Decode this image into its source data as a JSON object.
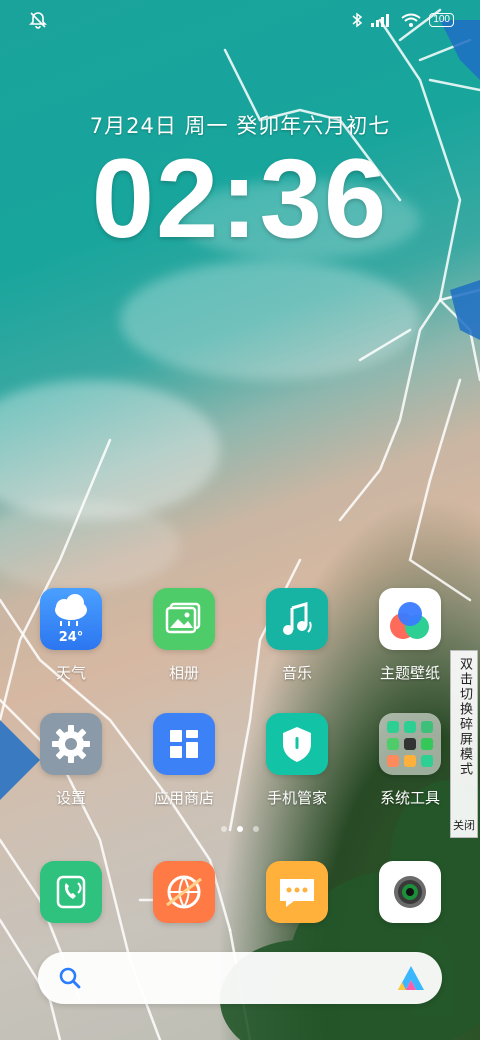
{
  "status_bar": {
    "left_icon": "mute-icon",
    "right_icons": [
      "bluetooth-icon",
      "signal-icon",
      "wifi-icon"
    ],
    "battery": "100"
  },
  "lockscreen_widget": {
    "date": "7月24日 周一 癸卯年六月初七",
    "time": "02:36"
  },
  "apps_row1": [
    {
      "label": "天气",
      "icon": "weather-icon",
      "temp": "24°"
    },
    {
      "label": "相册",
      "icon": "gallery-icon"
    },
    {
      "label": "音乐",
      "icon": "music-icon"
    },
    {
      "label": "主题壁纸",
      "icon": "theme-icon"
    }
  ],
  "apps_row2": [
    {
      "label": "设置",
      "icon": "settings-icon"
    },
    {
      "label": "应用商店",
      "icon": "app-store-icon"
    },
    {
      "label": "手机管家",
      "icon": "phone-manager-icon"
    },
    {
      "label": "系统工具",
      "icon": "folder-icon"
    }
  ],
  "dock": [
    {
      "icon": "phone-icon"
    },
    {
      "icon": "browser-icon"
    },
    {
      "icon": "messages-icon"
    },
    {
      "icon": "camera-icon"
    }
  ],
  "page_indicator": {
    "count": 3,
    "active": 2
  },
  "side_tab": {
    "text": "双击切换碎屏模式",
    "close": "关闭"
  },
  "colors": {
    "weather": "#3b8cff",
    "gallery": "#4fcc6a",
    "music": "#17b4a4",
    "settings": "#8a9aa8",
    "appstore": "#3c82f6",
    "manager": "#12c3a6",
    "phone": "#2ec27e",
    "browser": "#ff7a45",
    "messages": "#ffb13b"
  }
}
